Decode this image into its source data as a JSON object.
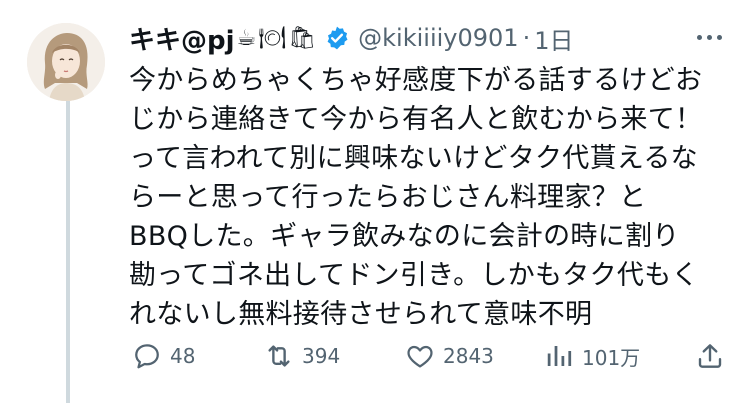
{
  "tweet": {
    "author_name": "キキ@pj",
    "name_emojis": [
      "☕",
      "🍽",
      "🛍"
    ],
    "handle": "@kikiiiiy0901",
    "separator": "·",
    "time": "1日",
    "text_lines": [
      "今からめちゃくちゃ好感度下がる話するけどお",
      "じから連絡きて今から有名人と飲むから来て！",
      "って言われて別に興味ないけどタク代貰えるな",
      "らーと思って行ったらおじさん料理家？と",
      "BBQした。ギャラ飲みなのに会計の時に割り",
      "勘ってゴネ出してドン引き。しかもタク代もく",
      "れないし無料接待させられて意味不明"
    ]
  },
  "actions": {
    "replies": "48",
    "retweets": "394",
    "likes": "2843",
    "views": "101万"
  },
  "colors": {
    "text": "#0f1419",
    "secondary": "#536471",
    "verified": "#1d9bf0",
    "thread_line": "#cfd9de"
  },
  "icons": [
    "avatar",
    "verified-badge-icon",
    "more-icon",
    "reply-icon",
    "retweet-icon",
    "like-icon",
    "views-icon",
    "share-icon"
  ]
}
